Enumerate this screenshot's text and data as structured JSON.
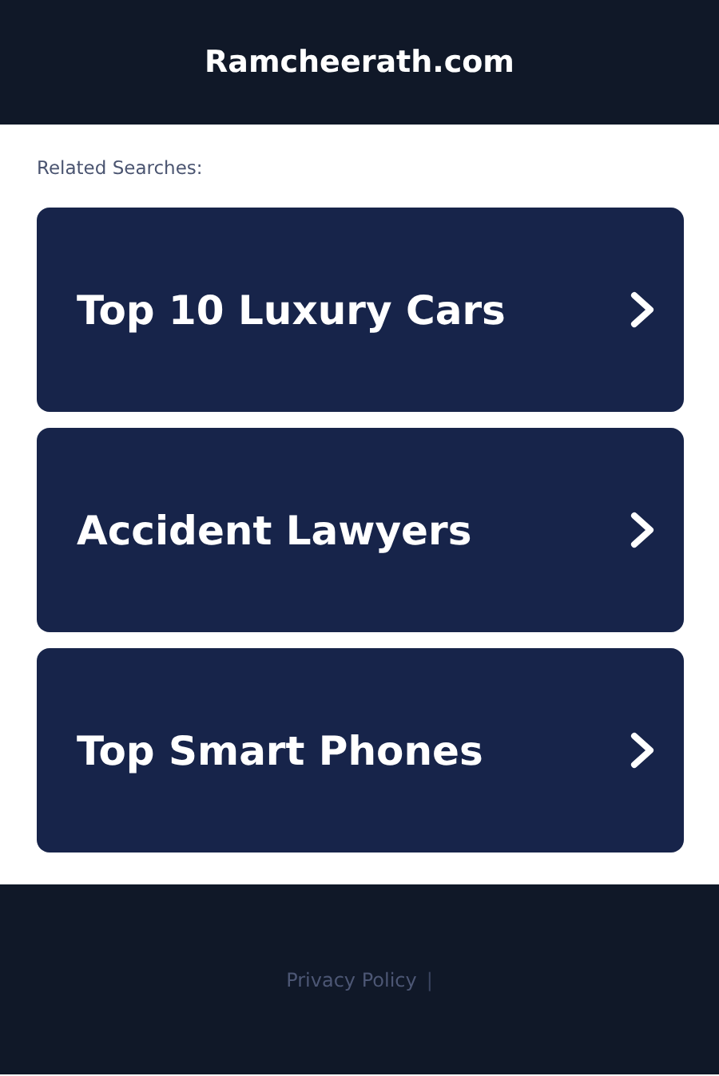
{
  "header": {
    "title": "Ramcheerath.com"
  },
  "related": {
    "label": "Related Searches:",
    "items": [
      {
        "label": "Top 10 Luxury Cars"
      },
      {
        "label": "Accident Lawyers"
      },
      {
        "label": "Top Smart Phones"
      }
    ]
  },
  "footer": {
    "links": [
      "Privacy Policy"
    ],
    "separator": "|"
  }
}
